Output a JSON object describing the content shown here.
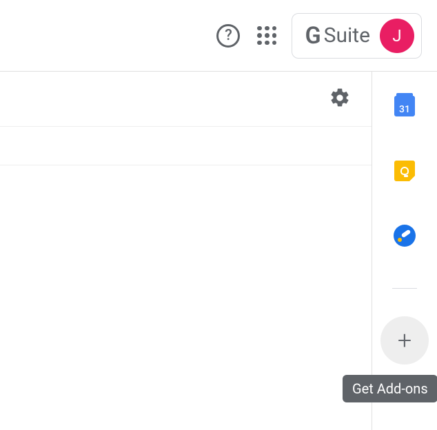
{
  "header": {
    "help_aria": "Help",
    "apps_aria": "Google apps",
    "suite_label": "G Suite",
    "avatar_initial": "J"
  },
  "content": {
    "settings_aria": "Settings"
  },
  "side_panel": {
    "calendar": {
      "day": "31",
      "aria": "Calendar"
    },
    "keep": {
      "aria": "Keep"
    },
    "tasks": {
      "aria": "Tasks"
    },
    "add": {
      "aria": "Get Add-ons",
      "glyph": "+"
    }
  },
  "tooltip": {
    "text": "Get Add-ons"
  }
}
